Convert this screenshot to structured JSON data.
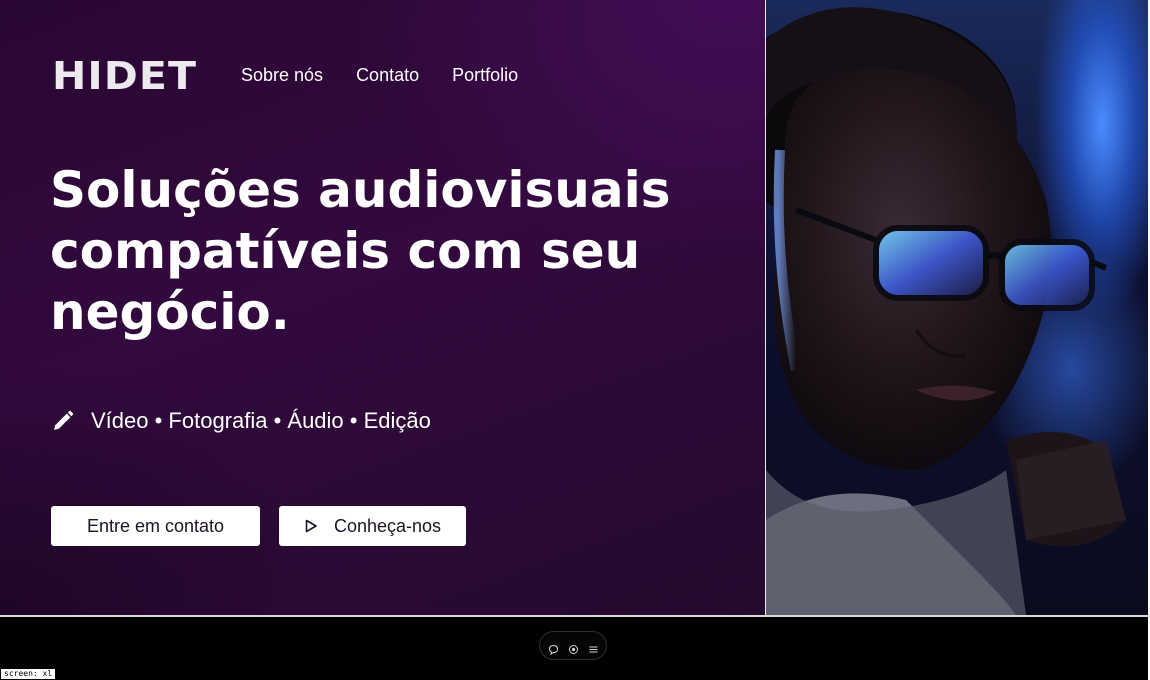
{
  "header": {
    "logo": "HIDET",
    "nav": [
      {
        "label": "Sobre nós"
      },
      {
        "label": "Contato"
      },
      {
        "label": "Portfolio"
      }
    ]
  },
  "hero": {
    "headline_lines": [
      "Soluções audiovisuais",
      "compatíveis com seu",
      "negócio."
    ],
    "services_icon": "pencil-icon",
    "services": "Vídeo • Fotografia • Áudio • Edição",
    "cta_primary": "Entre em contato",
    "cta_secondary": "Conheça-nos",
    "cta_secondary_icon": "play-icon"
  },
  "toolbar": {
    "icons": [
      "comment-icon",
      "eye-icon",
      "menu-icon"
    ]
  },
  "debug": {
    "screen_label": "screen: xl"
  },
  "colors": {
    "hero_background": "#2f0a3b",
    "button_background": "#ffffff",
    "bottom_bar": "#000000"
  }
}
